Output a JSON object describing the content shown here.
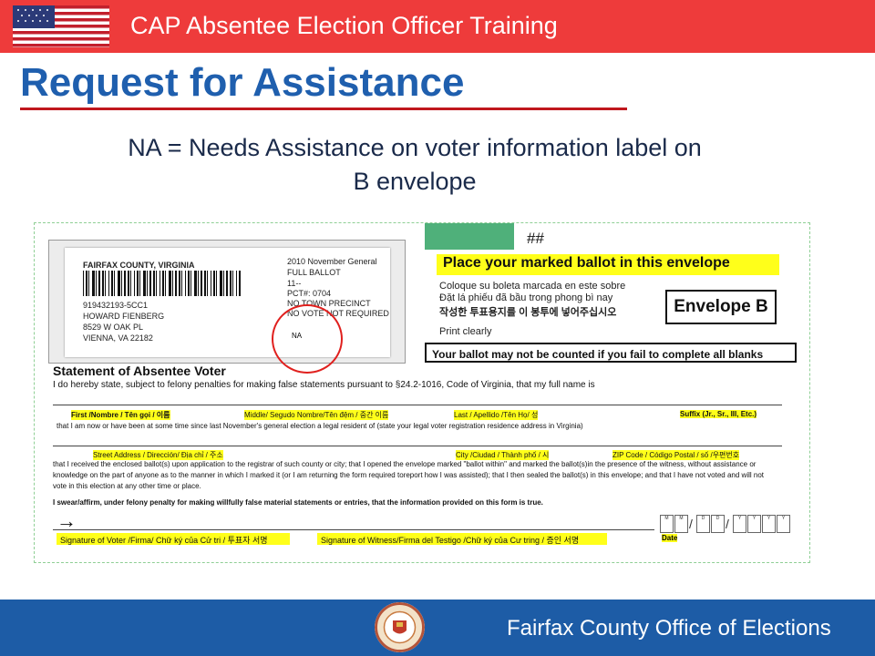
{
  "header": {
    "title": "CAP Absentee Election Officer Training"
  },
  "slide": {
    "title": "Request for Assistance",
    "subtitle_line1": "NA = Needs Assistance on voter information label on",
    "subtitle_line2": "B envelope"
  },
  "envelope": {
    "label": {
      "county": "FAIRFAX COUNTY, VIRGINIA",
      "election": "2010 November General",
      "ballot": "FULL BALLOT",
      "code": "11--",
      "pct": "PCT#: 0704",
      "precinct": "NO TOWN PRECINCT",
      "notreq": "NO VOTE NOT REQUIRED",
      "id": "919432193-5CC1",
      "name": "HOWARD FIENBERG",
      "street": "8529 W OAK PL",
      "city": "VIENNA, VA  22182",
      "na": "NA"
    },
    "hash": "##",
    "place_heading": "Place your marked ballot in this envelope",
    "multi": [
      "Coloque su boleta marcada en este sobre",
      "Đặt lá phiếu đã bầu trong phong bì nay",
      "작성한 투표용지를 이 봉투에 넣어주십시오"
    ],
    "print_clearly": "Print clearly",
    "envelope_label": "Envelope B",
    "warning": "Your ballot may not be counted if you fail to complete all blanks",
    "statement_title": "Statement of Absentee Voter",
    "statement_line": "I do hereby state, subject to felony penalties for making false statements pursuant to §24.2-1016, Code of Virginia, that my full name is",
    "fields": {
      "first": "First /Nombre / Tên gọi / 이름",
      "middle": "Middle/ Segudo Nombre/Tên đệm / 중간 이름",
      "last": "Last / Apellido /Tên Họ/ 성",
      "suffix": "Suffix (Jr., Sr., III, Etc.)",
      "resident": "that I am now or have been at some time since last November's general election a legal resident of (state your legal voter registration residence address in Virginia)",
      "street": "Street Address / Dirección/ Địa chỉ / 주소",
      "city": "City /Ciudad / Thành phố / 시",
      "zip": "ZIP  Code  / Código Postal / số /우편번호"
    },
    "paragraph": "that I received the enclosed ballot(s) upon application to the registrar of such county or city; that I opened the envelope marked \"ballot within\" and marked the ballot(s)in the presence of the witness, without assistance or knowledge on the part of anyone as to the manner in which I marked it (or I am returning the form required toreport how I was assisted); that I then sealed the ballot(s) in this envelope; and that I have not voted and will not vote in this election at any other time or place.",
    "swear": "I swear/affirm, under felony penalty for making willfully false material statements or entries, that the information provided on this form is true.",
    "arrow": "→",
    "sig_voter": "Signature of Voter /Firma/ Chữ ký của Cử tri / 투표자 서명",
    "sig_witness": "Signature of Witness/Firma del Testigo /Chữ ký của Cư tring / 증인 서명",
    "date": "Date",
    "date_m": "M",
    "date_d": "D",
    "date_y": "Y"
  },
  "footer": {
    "text": "Fairfax County Office of Elections"
  },
  "colors": {
    "top_bar": "#ee3b3b",
    "title_blue": "#1f5fae",
    "bottom_bar": "#1d5ca6",
    "highlight": "#ffff1a",
    "circle": "#e0201e"
  }
}
